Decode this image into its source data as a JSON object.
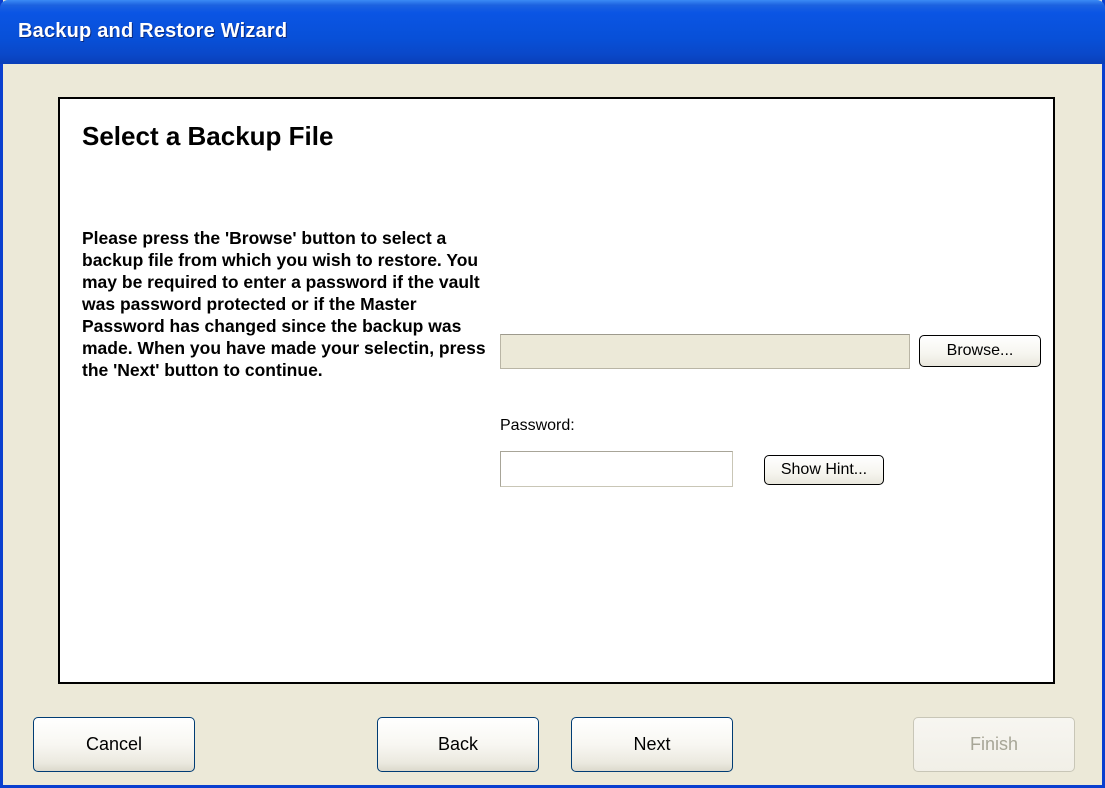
{
  "window": {
    "title": "Backup and Restore Wizard"
  },
  "page": {
    "title": "Select a Backup File",
    "instructions": "Please press the 'Browse' button to select a backup file from which you wish to restore. You may be required to enter a password if the vault was password protected or if the Master Password has changed since the backup was made. When you have made your selectin, press the 'Next' button to continue."
  },
  "file_selection": {
    "path_value": "",
    "browse_label": "Browse..."
  },
  "password": {
    "label": "Password:",
    "value": "",
    "hint_label": "Show Hint..."
  },
  "footer": {
    "cancel_label": "Cancel",
    "back_label": "Back",
    "next_label": "Next",
    "finish_label": "Finish",
    "finish_enabled": false
  },
  "colors": {
    "title_bar": "#0a55e4",
    "dialog_background": "#ece9d8",
    "panel_background": "#ffffff",
    "disabled_text": "#a7a697"
  }
}
